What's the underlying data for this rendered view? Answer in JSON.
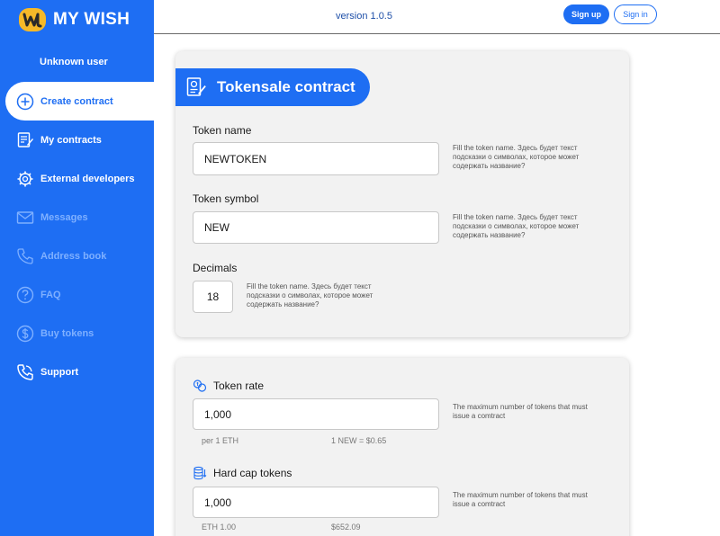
{
  "app": {
    "logo_text": "MY WISH",
    "user_name": "Unknown user",
    "version": "version 1.0.5",
    "accent_color": "#1e6ef3"
  },
  "header": {
    "signup_label": "Sign up",
    "signin_label": "Sign in"
  },
  "sidebar": {
    "items": [
      {
        "label": "Create contract",
        "icon": "plus-circle-icon",
        "state": "active"
      },
      {
        "label": "My contracts",
        "icon": "contract-icon",
        "state": "normal"
      },
      {
        "label": "External developers",
        "icon": "gear-icon",
        "state": "normal"
      },
      {
        "label": "Messages",
        "icon": "mail-icon",
        "state": "disabled"
      },
      {
        "label": "Address book",
        "icon": "phone-icon",
        "state": "disabled"
      },
      {
        "label": "FAQ",
        "icon": "question-icon",
        "state": "disabled"
      },
      {
        "label": "Buy tokens",
        "icon": "dollar-icon",
        "state": "disabled"
      },
      {
        "label": "Support",
        "icon": "support-phone-icon",
        "state": "normal"
      }
    ]
  },
  "tokensale": {
    "title": "Tokensale contract",
    "token_name": {
      "label": "Token name",
      "value": "NEWTOKEN",
      "hint": "Fill the token name. Здесь будет текст подсказки о символах, которое может содержать название?"
    },
    "token_symbol": {
      "label": "Token symbol",
      "value": "NEW",
      "hint": "Fill the token name. Здесь будет текст подсказки о символах, которое может содержать название?"
    },
    "decimals": {
      "label": "Decimals",
      "value": "18",
      "hint": "Fill the token name. Здесь будет текст подсказки о символах, которое может содержать название?"
    }
  },
  "rates": {
    "token_rate": {
      "label": "Token rate",
      "value": "1,000",
      "hint": "The maximum number of tokens that must issue a comtract",
      "sub_left": "per 1 ETH",
      "sub_right": "1 NEW = $0.65"
    },
    "hard_cap": {
      "label": "Hard cap tokens",
      "value": "1,000",
      "hint": "The maximum number of tokens that must issue a comtract",
      "sub_left": "ETH 1.00",
      "sub_right": "$652.09"
    }
  }
}
